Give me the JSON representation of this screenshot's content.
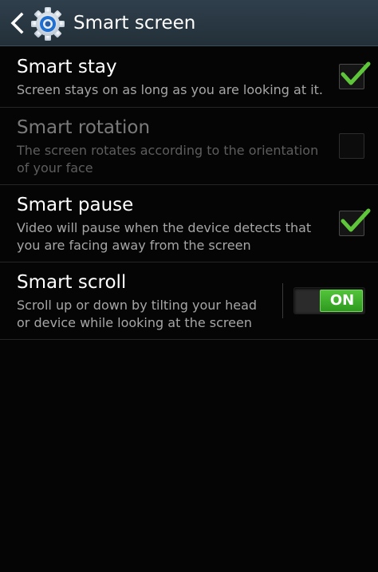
{
  "header": {
    "title": "Smart screen",
    "back_icon": "chevron-left-icon",
    "app_icon": "gear-icon",
    "accent_color": "#2f3f4c"
  },
  "settings": [
    {
      "title": "Smart stay",
      "summary": "Screen stays on as long as you are looking at it.",
      "control": "checkbox",
      "checked": true,
      "enabled": true
    },
    {
      "title": "Smart rotation",
      "summary": "The screen rotates according to the orientation of your face",
      "control": "checkbox",
      "checked": false,
      "enabled": false
    },
    {
      "title": "Smart pause",
      "summary": "Video will pause when the device detects that you are facing away from the screen",
      "control": "checkbox",
      "checked": true,
      "enabled": true
    },
    {
      "title": "Smart scroll",
      "summary": "Scroll up or down by tilting your head or device while looking at the screen",
      "control": "switch",
      "switch_label": "ON",
      "on": true,
      "enabled": true
    }
  ],
  "colors": {
    "check": "#5fc53a",
    "switch_on": "#3aa829"
  }
}
